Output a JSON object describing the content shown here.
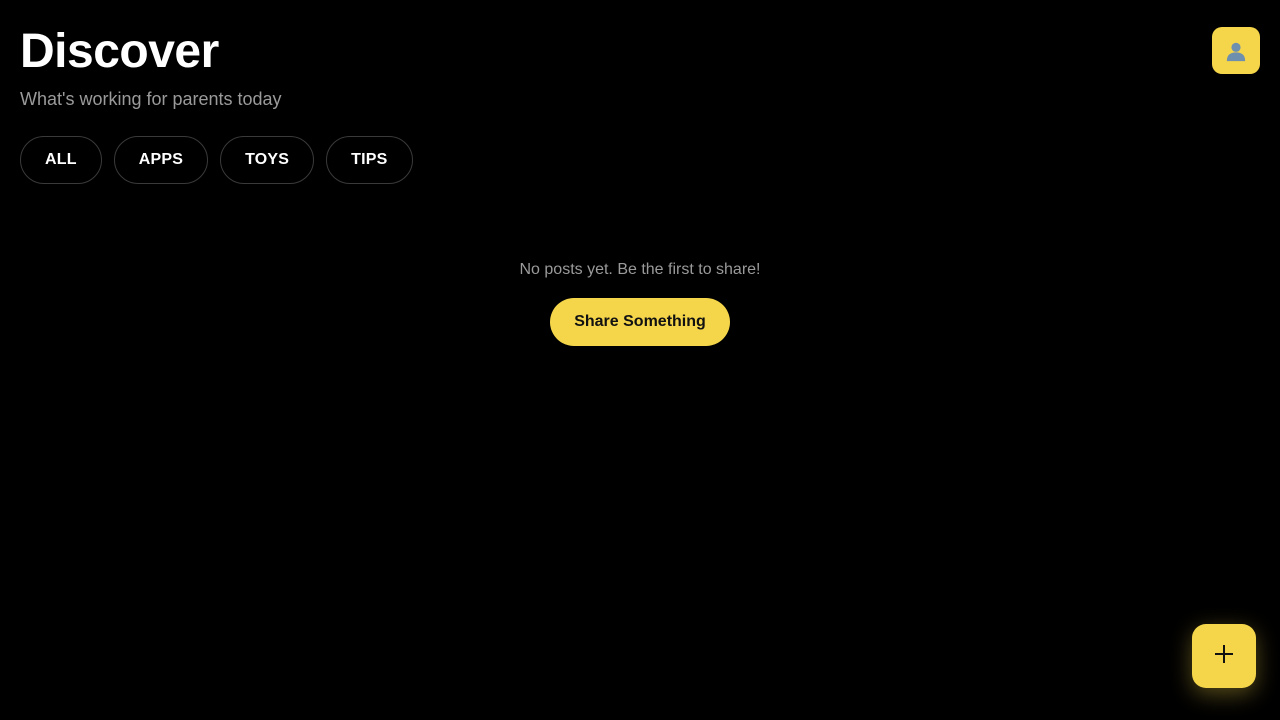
{
  "header": {
    "title": "Discover",
    "subtitle": "What's working for parents today"
  },
  "profile": {
    "icon": "user-icon"
  },
  "filters": [
    {
      "label": "ALL"
    },
    {
      "label": "APPS"
    },
    {
      "label": "TOYS"
    },
    {
      "label": "TIPS"
    }
  ],
  "empty_state": {
    "message": "No posts yet. Be the first to share!",
    "cta_label": "Share Something"
  },
  "fab": {
    "icon": "plus-icon",
    "glyph": "+"
  },
  "colors": {
    "background": "#000000",
    "accent": "#f5d64a",
    "muted_text": "#9a9a9a",
    "chip_border": "#3a3a3a"
  }
}
